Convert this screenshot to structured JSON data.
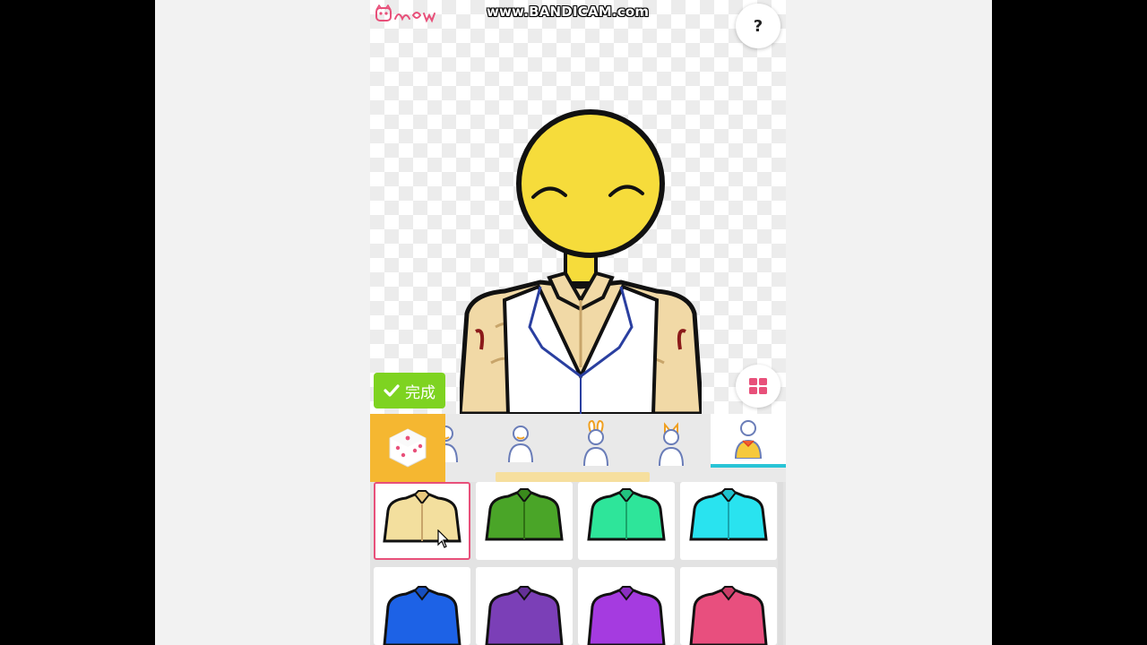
{
  "app": {
    "logo_text": "Picrew",
    "watermark": "www.BANDICAM.com",
    "help_label": "?",
    "done_label": "完成",
    "icons": {
      "logo": "picrew-logo",
      "help": "question-mark-icon",
      "done": "checkmark-icon",
      "grid": "grid-icon",
      "dice": "dice-icon"
    }
  },
  "character": {
    "face": "smiling-closed-eyes",
    "head_color": "#f6dc3b",
    "shirt_color": "#f1d9a6",
    "vest_color": "#ffffff"
  },
  "tabs": [
    {
      "name": "tab-body-partial",
      "active": false
    },
    {
      "name": "tab-body",
      "active": false
    },
    {
      "name": "tab-bunny-ears",
      "active": false
    },
    {
      "name": "tab-cat-ears",
      "active": false
    },
    {
      "name": "tab-shirt",
      "active": true
    }
  ],
  "items": [
    {
      "name": "shirt-cream",
      "color": "#f3df9e",
      "selected": true
    },
    {
      "name": "shirt-green",
      "color": "#4aa528",
      "selected": false
    },
    {
      "name": "shirt-mint",
      "color": "#2ee59a",
      "selected": false
    },
    {
      "name": "shirt-cyan",
      "color": "#29e3ef",
      "selected": false
    },
    {
      "name": "shirt-blue",
      "color": "#1d62e6",
      "selected": false
    },
    {
      "name": "shirt-purple",
      "color": "#7b3fb7",
      "selected": false
    },
    {
      "name": "shirt-violet",
      "color": "#a53be0",
      "selected": false
    },
    {
      "name": "shirt-pink",
      "color": "#e84f7e",
      "selected": false
    }
  ]
}
